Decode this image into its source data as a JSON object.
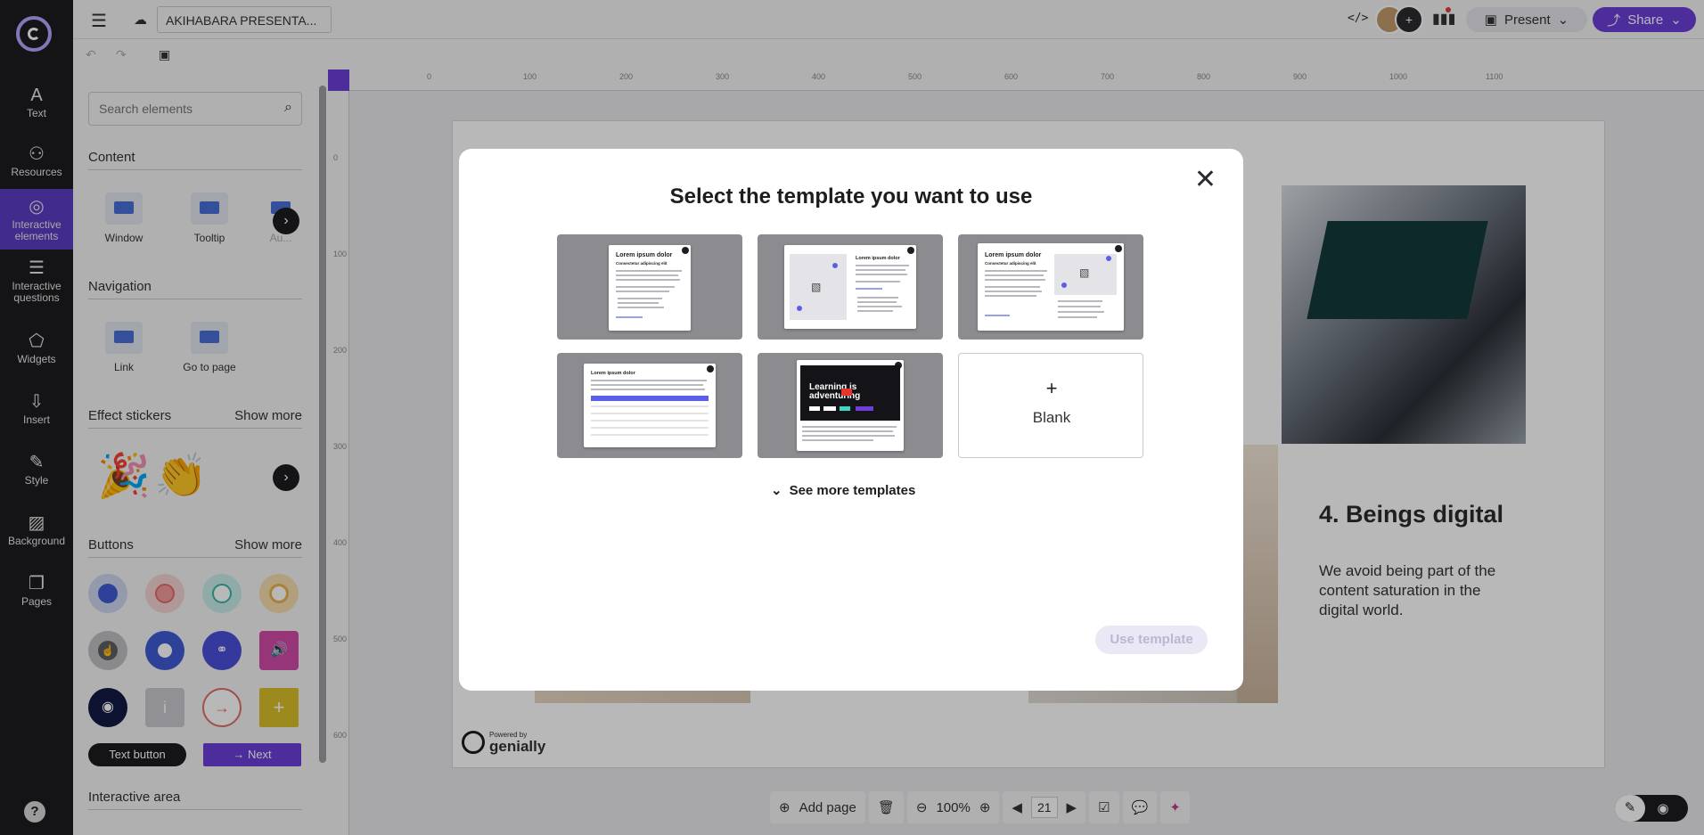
{
  "rail": {
    "items": [
      {
        "label": "Text",
        "icon": "A"
      },
      {
        "label": "Resources",
        "icon": "⚇"
      },
      {
        "label": "Interactive elements",
        "icon": "◎"
      },
      {
        "label": "Interactive questions",
        "icon": "☰"
      },
      {
        "label": "Widgets",
        "icon": "⬠"
      },
      {
        "label": "Insert",
        "icon": "⇩"
      },
      {
        "label": "Style",
        "icon": "✎"
      },
      {
        "label": "Background",
        "icon": "▨"
      },
      {
        "label": "Pages",
        "icon": "❐"
      }
    ],
    "help": "?"
  },
  "topbar": {
    "title": "AKIHABARA PRESENTA...",
    "present_label": "Present",
    "share_label": "Share"
  },
  "panel": {
    "search_placeholder": "Search elements",
    "content_title": "Content",
    "content_items": [
      "Window",
      "Tooltip",
      "Au..."
    ],
    "navigation_title": "Navigation",
    "navigation_items": [
      "Link",
      "Go to page"
    ],
    "effect_title": "Effect stickers",
    "effect_more": "Show more",
    "buttons_title": "Buttons",
    "buttons_more": "Show more",
    "text_button": "Text button",
    "next_button": "→ Next",
    "interactive_area_title": "Interactive area"
  },
  "ruler": {
    "top_ticks": [
      "0",
      "100",
      "200",
      "300",
      "400",
      "500",
      "600",
      "700",
      "800",
      "900",
      "1000",
      "1100"
    ],
    "left_ticks": [
      "0",
      "100",
      "200",
      "300",
      "400",
      "500",
      "600"
    ]
  },
  "slide": {
    "heading": "4. Beings digital",
    "body": "We avoid being part of the content saturation in the digital world.",
    "powered_by": "Powered by",
    "brand": "genially"
  },
  "bottombar": {
    "add_page": "Add page",
    "zoom": "100%",
    "page_number": "21"
  },
  "modal": {
    "title": "Select the template you want to use",
    "templates": [
      {
        "heading": "Lorem ipsum dolor",
        "subheading": "Consectetur adipiscing elit"
      },
      {
        "heading": "Lorem ipsum dolor",
        "subheading": ""
      },
      {
        "heading": "Lorem ipsum dolor",
        "subheading": "Consectetur adipiscing elit"
      },
      {
        "heading": "Lorem ipsum dolor",
        "subheading": ""
      },
      {
        "heading": "Learning is adventuring",
        "subheading": ""
      }
    ],
    "blank_plus": "+",
    "blank_label": "Blank",
    "see_more": "See more templates",
    "use_template": "Use template"
  },
  "colors": {
    "accent": "#6b3fd8",
    "rail_bg": "#1d1d1f",
    "active_rail": "#5b3cc4"
  }
}
